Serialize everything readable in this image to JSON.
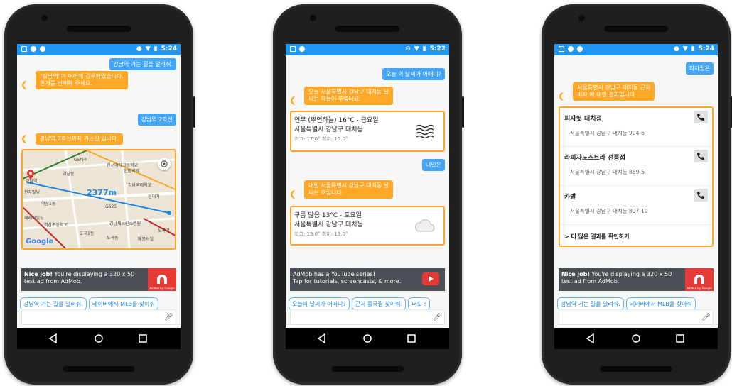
{
  "phones": [
    {
      "time": "5:24",
      "messages": {
        "user_top": "강남역 가는 길을 알려줘.",
        "bot_1_line1": "\"강남역\"가 여러개 검색되었습니다.",
        "bot_1_line2": "한개를 선택해 주세요.",
        "user_2": "강남역 2호선",
        "bot_2": "강남역 2호선까지 가는길 입니다."
      },
      "map": {
        "distance": "2377m",
        "labels": [
          "G5타워",
          "진선여자고등학교",
          "한림국제",
          "역삼동",
          "강남국제학교",
          "현대아",
          "전자빌딩",
          "역삼1동",
          "GS25",
          "헤레이빌딩",
          "역삼초등학교",
          "강남세브란스병원",
          "도국1동",
          "도곡동",
          "도곡역",
          "매봉터널",
          "도곡1동"
        ],
        "logo": "Google",
        "station": "강남역"
      },
      "ad": {
        "bold": "Nice job!",
        "text": " You're displaying a 320 x 50 test ad from AdMob.",
        "brand": "AdMob by Google"
      },
      "chips": [
        "강남역 가는 길을 알려줘.",
        "네이버에서 MLB을 찾아줘"
      ]
    },
    {
      "time": "5:22",
      "messages": {
        "user_1": "오늘 의 날씨가 어때니?",
        "bot_1_line1": "오늘 서울특별시 강남구 대치동 날",
        "bot_1_line2": "씨는 하늘이 뿌옇네요.",
        "user_2": "내일은",
        "bot_2_line1": "내일 서울특별시 강남구 대치동 날",
        "bot_2_line2": "씨는 흐립니다."
      },
      "weather": [
        {
          "title": "연무 (뿌연하늘)  16°C - 금요일",
          "place": "서울특별시 강남구 대치동",
          "range": "최고: 17.0°  최저: 15.0°",
          "icon": "haze-icon"
        },
        {
          "title": "구름 많음  13°C - 토요일",
          "place": "서울특별시 강남구 대치동",
          "range": "최고: 13.0°  최저: 13.0°",
          "icon": "cloud-icon"
        }
      ],
      "ad": {
        "line1": "AdMob has a YouTube series!",
        "line2": "Tap for tutorials, screencasts, & more."
      },
      "chips": [
        "오늘의 날씨가 어떠니?",
        "근처 중국집 찾아줘.",
        "너도 !"
      ]
    },
    {
      "time": "5:24",
      "messages": {
        "user_1": "피자집은",
        "bot_1_line1": "서울특별시 강남구 대치동 근처",
        "bot_1_line2": "피자 에 대한 결과입니다"
      },
      "places": [
        {
          "name": "피자헛 대치점",
          "address": "서울특별시 강남구 대치동 994-6"
        },
        {
          "name": "라피자노스트라 선릉점",
          "address": "서울특별시 강남구 대치동 889-5"
        },
        {
          "name": "카발",
          "address": "서울특별시 강남구 대치동 897-10"
        }
      ],
      "more": "> 더 많은 결과를 확인하기",
      "ad": {
        "bold": "Nice job!",
        "text": " You're displaying a 320 x 50 test ad from AdMob.",
        "brand": "AdMob by Google"
      },
      "chips": [
        "강남역 가는 길을 알려줘.",
        "네이버에서 MLB을 찾아줘"
      ]
    }
  ],
  "colors": {
    "accent_blue": "#2196f3",
    "bot_orange": "#ffa726",
    "ad_red": "#e53935"
  }
}
